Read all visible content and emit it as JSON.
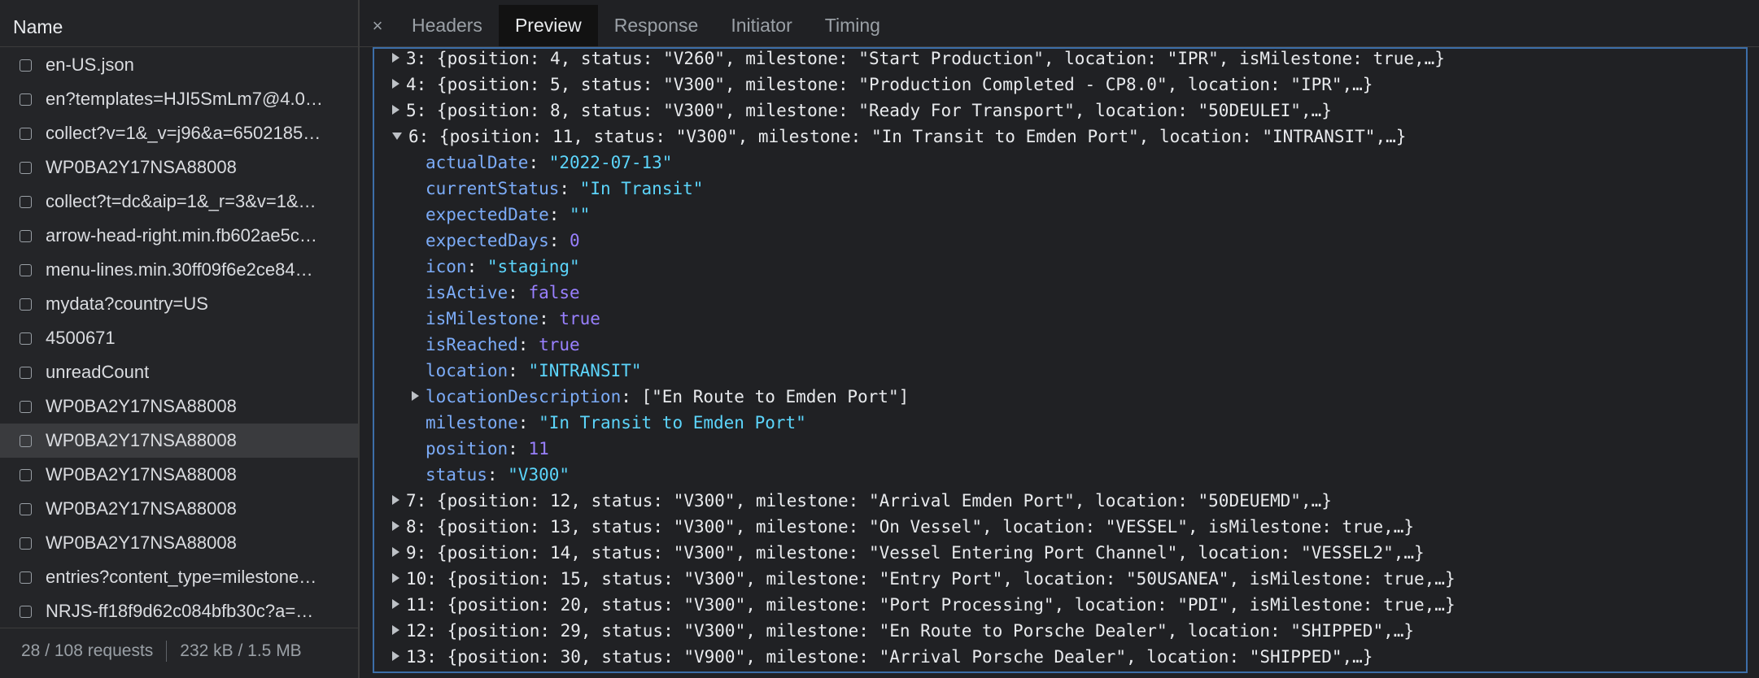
{
  "left_panel": {
    "header": "Name",
    "requests": [
      {
        "name": "en-US.json",
        "selected": false
      },
      {
        "name": "en?templates=HJI5SmLm7@4.0…",
        "selected": false
      },
      {
        "name": "collect?v=1&_v=j96&a=6502185…",
        "selected": false
      },
      {
        "name": "WP0BA2Y17NSA88008",
        "selected": false
      },
      {
        "name": "collect?t=dc&aip=1&_r=3&v=1&…",
        "selected": false
      },
      {
        "name": "arrow-head-right.min.fb602ae5c…",
        "selected": false
      },
      {
        "name": "menu-lines.min.30ff09f6e2ce84…",
        "selected": false
      },
      {
        "name": "mydata?country=US",
        "selected": false
      },
      {
        "name": "4500671",
        "selected": false
      },
      {
        "name": "unreadCount",
        "selected": false
      },
      {
        "name": "WP0BA2Y17NSA88008",
        "selected": false
      },
      {
        "name": "WP0BA2Y17NSA88008",
        "selected": true
      },
      {
        "name": "WP0BA2Y17NSA88008",
        "selected": false
      },
      {
        "name": "WP0BA2Y17NSA88008",
        "selected": false
      },
      {
        "name": "WP0BA2Y17NSA88008",
        "selected": false
      },
      {
        "name": "entries?content_type=milestone…",
        "selected": false
      },
      {
        "name": "NRJS-ff18f9d62c084bfb30c?a=…",
        "selected": false
      }
    ],
    "footer": {
      "requests": "28 / 108 requests",
      "transfer": "232 kB / 1.5 MB"
    }
  },
  "tabs": {
    "close": "×",
    "items": [
      {
        "label": "Headers",
        "active": false
      },
      {
        "label": "Preview",
        "active": true
      },
      {
        "label": "Response",
        "active": false
      },
      {
        "label": "Initiator",
        "active": false
      },
      {
        "label": "Timing",
        "active": false
      }
    ]
  },
  "preview": {
    "lines": [
      {
        "indent": 0,
        "toggle": "right",
        "segs": [
          [
            "w",
            "3: {position: 4, status: \"V260\", milestone: \"Start Production\", location: \"IPR\", isMilestone: true,…}"
          ]
        ]
      },
      {
        "indent": 0,
        "toggle": "right",
        "segs": [
          [
            "w",
            "4: {position: 5, status: \"V300\", milestone: \"Production Completed - CP8.0\", location: \"IPR\",…}"
          ]
        ]
      },
      {
        "indent": 0,
        "toggle": "right",
        "segs": [
          [
            "w",
            "5: {position: 8, status: \"V300\", milestone: \"Ready For Transport\", location: \"50DEULEI\",…}"
          ]
        ]
      },
      {
        "indent": 0,
        "toggle": "down",
        "segs": [
          [
            "w",
            "6: {position: 11, status: \"V300\", milestone: \"In Transit to Emden Port\", location: \"INTRANSIT\",…}"
          ]
        ]
      },
      {
        "indent": 1,
        "toggle": "none",
        "segs": [
          [
            "k",
            "actualDate"
          ],
          [
            "w",
            ": "
          ],
          [
            "s",
            "\"2022-07-13\""
          ]
        ]
      },
      {
        "indent": 1,
        "toggle": "none",
        "segs": [
          [
            "k",
            "currentStatus"
          ],
          [
            "w",
            ": "
          ],
          [
            "s",
            "\"In Transit\""
          ]
        ]
      },
      {
        "indent": 1,
        "toggle": "none",
        "segs": [
          [
            "k",
            "expectedDate"
          ],
          [
            "w",
            ": "
          ],
          [
            "s",
            "\"\""
          ]
        ]
      },
      {
        "indent": 1,
        "toggle": "none",
        "segs": [
          [
            "k",
            "expectedDays"
          ],
          [
            "w",
            ": "
          ],
          [
            "n",
            "0"
          ]
        ]
      },
      {
        "indent": 1,
        "toggle": "none",
        "segs": [
          [
            "k",
            "icon"
          ],
          [
            "w",
            ": "
          ],
          [
            "s",
            "\"staging\""
          ]
        ]
      },
      {
        "indent": 1,
        "toggle": "none",
        "segs": [
          [
            "k",
            "isActive"
          ],
          [
            "w",
            ": "
          ],
          [
            "b",
            "false"
          ]
        ]
      },
      {
        "indent": 1,
        "toggle": "none",
        "segs": [
          [
            "k",
            "isMilestone"
          ],
          [
            "w",
            ": "
          ],
          [
            "b",
            "true"
          ]
        ]
      },
      {
        "indent": 1,
        "toggle": "none",
        "segs": [
          [
            "k",
            "isReached"
          ],
          [
            "w",
            ": "
          ],
          [
            "b",
            "true"
          ]
        ]
      },
      {
        "indent": 1,
        "toggle": "none",
        "segs": [
          [
            "k",
            "location"
          ],
          [
            "w",
            ": "
          ],
          [
            "s",
            "\"INTRANSIT\""
          ]
        ]
      },
      {
        "indent": 1,
        "toggle": "right",
        "segs": [
          [
            "k",
            "locationDescription"
          ],
          [
            "w",
            ": [\"En Route to Emden Port\"]"
          ]
        ]
      },
      {
        "indent": 1,
        "toggle": "none",
        "segs": [
          [
            "k",
            "milestone"
          ],
          [
            "w",
            ": "
          ],
          [
            "s",
            "\"In Transit to Emden Port\""
          ]
        ]
      },
      {
        "indent": 1,
        "toggle": "none",
        "segs": [
          [
            "k",
            "position"
          ],
          [
            "w",
            ": "
          ],
          [
            "n",
            "11"
          ]
        ]
      },
      {
        "indent": 1,
        "toggle": "none",
        "segs": [
          [
            "k",
            "status"
          ],
          [
            "w",
            ": "
          ],
          [
            "s",
            "\"V300\""
          ]
        ]
      },
      {
        "indent": 0,
        "toggle": "right",
        "segs": [
          [
            "w",
            "7: {position: 12, status: \"V300\", milestone: \"Arrival Emden Port\", location: \"50DEUEMD\",…}"
          ]
        ]
      },
      {
        "indent": 0,
        "toggle": "right",
        "segs": [
          [
            "w",
            "8: {position: 13, status: \"V300\", milestone: \"On Vessel\", location: \"VESSEL\", isMilestone: true,…}"
          ]
        ]
      },
      {
        "indent": 0,
        "toggle": "right",
        "segs": [
          [
            "w",
            "9: {position: 14, status: \"V300\", milestone: \"Vessel Entering Port Channel\", location: \"VESSEL2\",…}"
          ]
        ]
      },
      {
        "indent": 0,
        "toggle": "right",
        "segs": [
          [
            "w",
            "10: {position: 15, status: \"V300\", milestone: \"Entry Port\", location: \"50USANEA\", isMilestone: true,…}"
          ]
        ]
      },
      {
        "indent": 0,
        "toggle": "right",
        "segs": [
          [
            "w",
            "11: {position: 20, status: \"V300\", milestone: \"Port Processing\", location: \"PDI\", isMilestone: true,…}"
          ]
        ]
      },
      {
        "indent": 0,
        "toggle": "right",
        "segs": [
          [
            "w",
            "12: {position: 29, status: \"V300\", milestone: \"En Route to Porsche Dealer\", location: \"SHIPPED\",…}"
          ]
        ]
      },
      {
        "indent": 0,
        "toggle": "right",
        "segs": [
          [
            "w",
            "13: {position: 30, status: \"V900\", milestone: \"Arrival Porsche Dealer\", location: \"SHIPPED\",…}"
          ]
        ]
      }
    ]
  }
}
